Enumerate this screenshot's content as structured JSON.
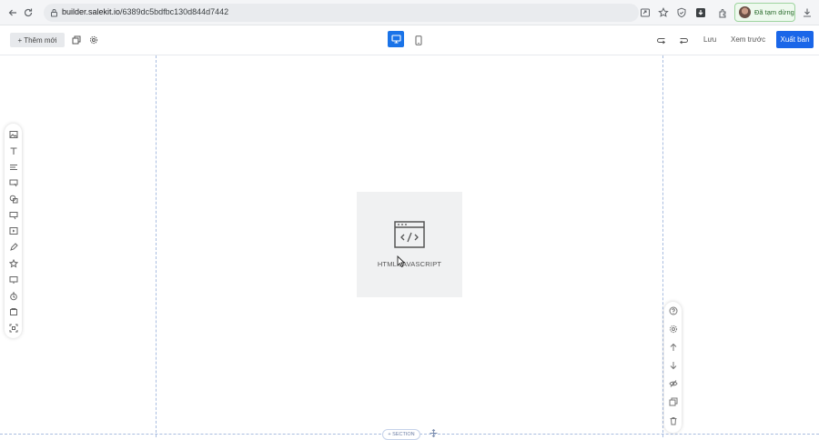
{
  "browser": {
    "url_host": "builder.salekit.io",
    "url_path": "/6389dc5bdfbc130d844d7442",
    "profile_label": "Đã tạm dừng",
    "icons": [
      "back-icon",
      "reload-icon",
      "site-info-icon",
      "share-icon",
      "bookmark-star-icon",
      "shield-icon",
      "download-box-icon",
      "extensions-icon",
      "downloads-icon"
    ]
  },
  "toolbar": {
    "add_new_label": "+ Thêm mới",
    "save_label": "Lưu",
    "preview_label": "Xem trước",
    "publish_label": "Xuất bản",
    "active_device": "desktop",
    "accent_color": "#1a73e8"
  },
  "left_tools": [
    "image-icon",
    "text-icon",
    "paragraph-icon",
    "button-icon",
    "shape-icon",
    "form-icon",
    "video-icon",
    "pen-icon",
    "star-icon",
    "popup-icon",
    "timer-icon",
    "gallery-icon",
    "frame-icon"
  ],
  "canvas": {
    "html_block_label": "HTML JAVASCRIPT",
    "section_label": "+ SECTION"
  },
  "right_tools": [
    "help-icon",
    "settings-icon",
    "move-up-icon",
    "move-down-icon",
    "hide-icon",
    "duplicate-icon",
    "delete-icon"
  ]
}
